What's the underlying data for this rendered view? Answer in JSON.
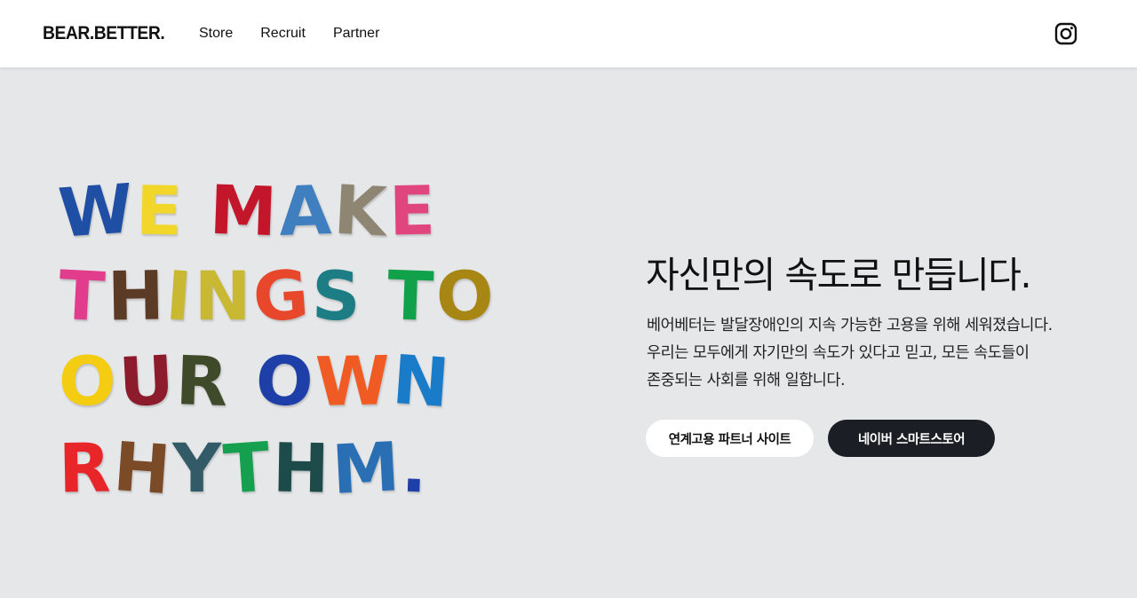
{
  "header": {
    "logo": "BEAR.BETTER.",
    "nav": [
      "Store",
      "Recruit",
      "Partner"
    ],
    "instagram_icon": "instagram-icon"
  },
  "hero": {
    "art_lines": [
      [
        {
          "t": "W",
          "c": "#1f4fa5"
        },
        {
          "t": "E",
          "c": "#f2d72a"
        },
        {
          "t": " "
        },
        {
          "t": "M",
          "c": "#c4162b"
        },
        {
          "t": "A",
          "c": "#3f7fc0"
        },
        {
          "t": "K",
          "c": "#8e8672"
        },
        {
          "t": "E",
          "c": "#e0457e"
        }
      ],
      [
        {
          "t": "T",
          "c": "#e23c8c"
        },
        {
          "t": "H",
          "c": "#5b3a26"
        },
        {
          "t": "I",
          "c": "#c9b832"
        },
        {
          "t": "N",
          "c": "#c9b832"
        },
        {
          "t": "G",
          "c": "#e8472b"
        },
        {
          "t": "S",
          "c": "#1c7d85"
        },
        {
          "t": " "
        },
        {
          "t": "T",
          "c": "#12a14b"
        },
        {
          "t": "O",
          "c": "#a88614"
        }
      ],
      [
        {
          "t": "O",
          "c": "#f4cd12"
        },
        {
          "t": "U",
          "c": "#8c1c2b"
        },
        {
          "t": "R",
          "c": "#3e4a2a"
        },
        {
          "t": " "
        },
        {
          "t": "O",
          "c": "#1f3fa8"
        },
        {
          "t": "W",
          "c": "#f05a23"
        },
        {
          "t": "N",
          "c": "#1a7bc8"
        }
      ],
      [
        {
          "t": "R",
          "c": "#e8262a"
        },
        {
          "t": "H",
          "c": "#7b4a26"
        },
        {
          "t": "Y",
          "c": "#335a67"
        },
        {
          "t": "T",
          "c": "#15a050"
        },
        {
          "t": "H",
          "c": "#1d4b4a"
        },
        {
          "t": "M",
          "c": "#2a6fb4"
        },
        {
          "t": ".",
          "c": "#1f3fa8"
        }
      ]
    ],
    "headline": "자신만의 속도로 만듭니다.",
    "description": [
      "베어베터는 발달장애인의 지속 가능한 고용을 위해 세워졌습니다.",
      "우리는 모두에게 자기만의 속도가 있다고 믿고, 모든 속도들이",
      "존중되는 사회를 위해 일합니다."
    ],
    "buttons": {
      "partner_label": "연계고용 파트너 사이트",
      "store_label": "네이버 스마트스토어"
    }
  }
}
